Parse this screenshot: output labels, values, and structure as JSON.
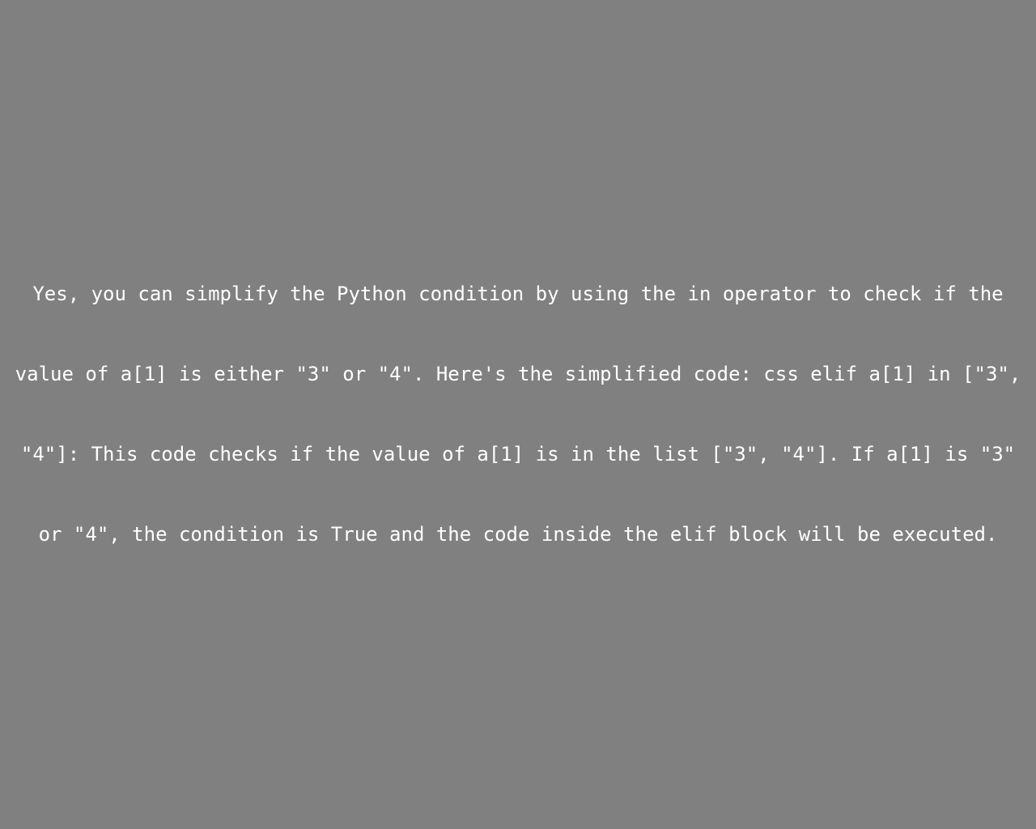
{
  "colors": {
    "background": "#808080",
    "text": "#ffffff"
  },
  "message": {
    "text": "Yes, you can simplify the Python condition by using the in operator to check if the value of a[1] is either \"3\" or \"4\". Here's the simplified code: css elif a[1] in [\"3\", \"4\"]: This code checks if the value of a[1] is in the list [\"3\", \"4\"]. If a[1] is \"3\" or \"4\", the condition is True and the code inside the elif block will be executed."
  }
}
